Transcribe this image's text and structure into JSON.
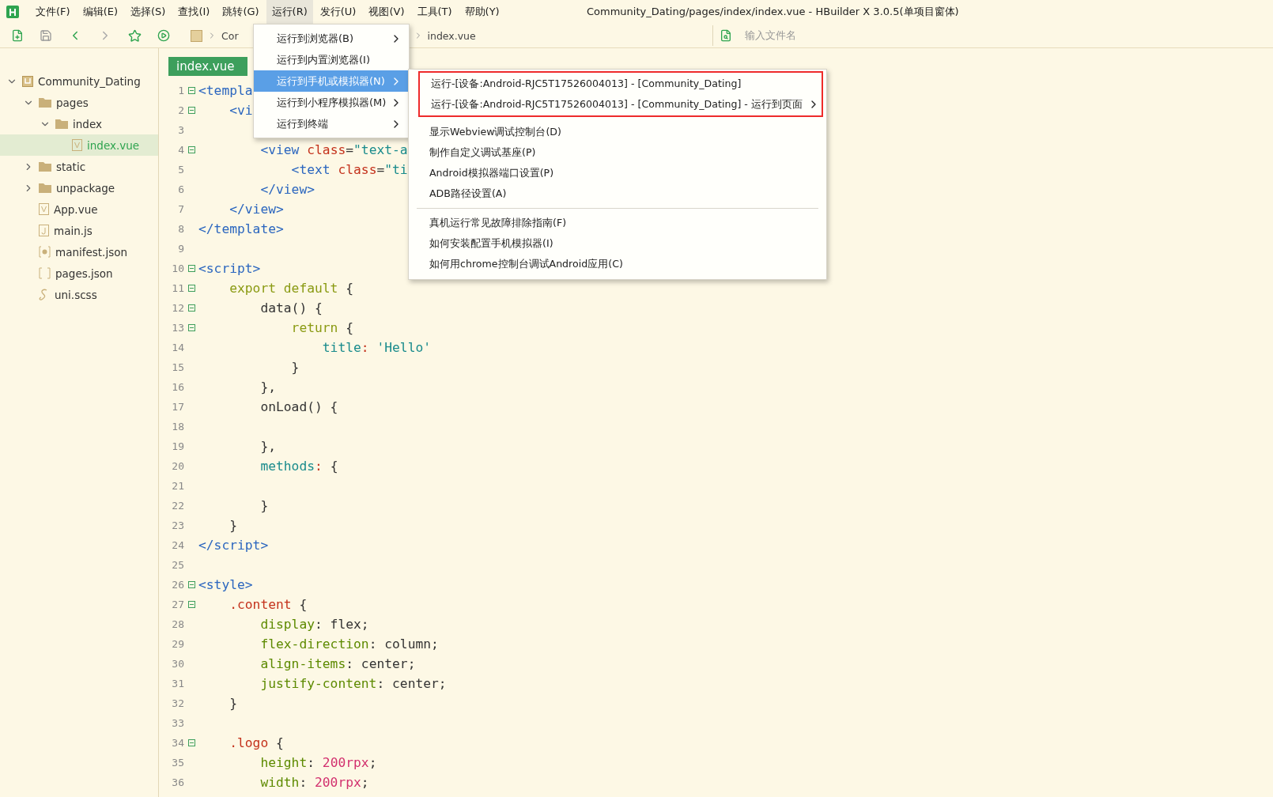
{
  "window": {
    "title": "Community_Dating/pages/index/index.vue - HBuilder X 3.0.5(单项目窗体)"
  },
  "menu_bar": [
    {
      "label": "文件(F)",
      "selected": false
    },
    {
      "label": "编辑(E)",
      "selected": false
    },
    {
      "label": "选择(S)",
      "selected": false
    },
    {
      "label": "查找(I)",
      "selected": false
    },
    {
      "label": "跳转(G)",
      "selected": false
    },
    {
      "label": "运行(R)",
      "selected": true
    },
    {
      "label": "发行(U)",
      "selected": false
    },
    {
      "label": "视图(V)",
      "selected": false
    },
    {
      "label": "工具(T)",
      "selected": false
    },
    {
      "label": "帮助(Y)",
      "selected": false
    }
  ],
  "toolbar": {
    "breadcrumb": [
      "Cor",
      "index.vue"
    ],
    "search": {
      "placeholder": "输入文件名"
    }
  },
  "sidebar": {
    "tree": [
      {
        "label": "Community_Dating",
        "kind": "project",
        "expanded": true,
        "selected": false,
        "children": [
          {
            "label": "pages",
            "kind": "folder",
            "expanded": true,
            "selected": false,
            "children": [
              {
                "label": "index",
                "kind": "folder",
                "expanded": true,
                "selected": false,
                "children": [
                  {
                    "label": "index.vue",
                    "kind": "vue",
                    "selected": true
                  }
                ]
              }
            ]
          },
          {
            "label": "static",
            "kind": "folder",
            "expanded": false,
            "selected": false
          },
          {
            "label": "unpackage",
            "kind": "folder",
            "expanded": false,
            "selected": false
          },
          {
            "label": "App.vue",
            "kind": "vue",
            "selected": false
          },
          {
            "label": "main.js",
            "kind": "js",
            "selected": false
          },
          {
            "label": "manifest.json",
            "kind": "config",
            "selected": false
          },
          {
            "label": "pages.json",
            "kind": "json",
            "selected": false
          },
          {
            "label": "uni.scss",
            "kind": "scss",
            "selected": false
          }
        ]
      }
    ]
  },
  "editor": {
    "tabs": [
      {
        "label": "index.vue",
        "selected": true
      }
    ],
    "lines": [
      {
        "n": "1",
        "fold": true,
        "tokens": [
          {
            "text": "<templa",
            "kind": "tag"
          }
        ]
      },
      {
        "n": "2",
        "fold": true,
        "tokens": [
          {
            "text": "    <vi",
            "kind": "tag"
          }
        ]
      },
      {
        "n": "3",
        "fold": false
      },
      {
        "n": "4",
        "fold": true,
        "tokens": [
          {
            "text": "        <view ",
            "kind": "tag"
          },
          {
            "text": "class",
            "kind": "attr"
          },
          {
            "text": "=",
            "kind": "plain"
          },
          {
            "text": "\"text-a",
            "kind": "str"
          }
        ]
      },
      {
        "n": "5",
        "fold": false,
        "tokens": [
          {
            "text": "            <text ",
            "kind": "tag"
          },
          {
            "text": "class",
            "kind": "attr"
          },
          {
            "text": "=",
            "kind": "plain"
          },
          {
            "text": "\"ti",
            "kind": "str"
          }
        ]
      },
      {
        "n": "6",
        "fold": false,
        "tokens": [
          {
            "text": "        </view>",
            "kind": "tag"
          }
        ]
      },
      {
        "n": "7",
        "fold": false,
        "tokens": [
          {
            "text": "    </view>",
            "kind": "tag"
          }
        ]
      },
      {
        "n": "8",
        "fold": false,
        "tokens": [
          {
            "text": "</template>",
            "kind": "tag"
          }
        ]
      },
      {
        "n": "9",
        "fold": false
      },
      {
        "n": "10",
        "fold": true,
        "tokens": [
          {
            "text": "<script>",
            "kind": "tag"
          }
        ]
      },
      {
        "n": "11",
        "fold": true,
        "tokens": [
          {
            "text": "    export default",
            "kind": "kw"
          },
          {
            "text": " {",
            "kind": "plain"
          }
        ]
      },
      {
        "n": "12",
        "fold": true,
        "tokens": [
          {
            "text": "        data() {",
            "kind": "plain"
          }
        ]
      },
      {
        "n": "13",
        "fold": true,
        "tokens": [
          {
            "text": "            return",
            "kind": "kw"
          },
          {
            "text": " {",
            "kind": "plain"
          }
        ]
      },
      {
        "n": "14",
        "fold": false,
        "tokens": [
          {
            "text": "                title",
            "kind": "prop"
          },
          {
            "text": ":",
            "kind": "attr"
          },
          {
            "text": " 'Hello'",
            "kind": "str"
          }
        ]
      },
      {
        "n": "15",
        "fold": false,
        "tokens": [
          {
            "text": "            }",
            "kind": "plain"
          }
        ]
      },
      {
        "n": "16",
        "fold": false,
        "tokens": [
          {
            "text": "        },",
            "kind": "plain"
          }
        ]
      },
      {
        "n": "17",
        "fold": false,
        "tokens": [
          {
            "text": "        onLoad() {",
            "kind": "plain"
          }
        ]
      },
      {
        "n": "18",
        "fold": false
      },
      {
        "n": "19",
        "fold": false,
        "tokens": [
          {
            "text": "        },",
            "kind": "plain"
          }
        ]
      },
      {
        "n": "20",
        "fold": false,
        "tokens": [
          {
            "text": "        methods",
            "kind": "prop"
          },
          {
            "text": ":",
            "kind": "attr"
          },
          {
            "text": " {",
            "kind": "plain"
          }
        ]
      },
      {
        "n": "21",
        "fold": false
      },
      {
        "n": "22",
        "fold": false,
        "tokens": [
          {
            "text": "        }",
            "kind": "plain"
          }
        ]
      },
      {
        "n": "23",
        "fold": false,
        "tokens": [
          {
            "text": "    }",
            "kind": "plain"
          }
        ]
      },
      {
        "n": "24",
        "fold": false,
        "tokens": [
          {
            "text": "</script>",
            "kind": "tag"
          }
        ]
      },
      {
        "n": "25",
        "fold": false
      },
      {
        "n": "26",
        "fold": true,
        "tokens": [
          {
            "text": "<style>",
            "kind": "tag"
          }
        ]
      },
      {
        "n": "27",
        "fold": true,
        "tokens": [
          {
            "text": "    .content",
            "kind": "attr"
          },
          {
            "text": " {",
            "kind": "plain"
          }
        ]
      },
      {
        "n": "28",
        "fold": false,
        "tokens": [
          {
            "text": "        display",
            "kind": "cssprop"
          },
          {
            "text": ": flex;",
            "kind": "plain"
          }
        ]
      },
      {
        "n": "29",
        "fold": false,
        "tokens": [
          {
            "text": "        flex-direction",
            "kind": "cssprop"
          },
          {
            "text": ": column;",
            "kind": "plain"
          }
        ]
      },
      {
        "n": "30",
        "fold": false,
        "tokens": [
          {
            "text": "        align-items",
            "kind": "cssprop"
          },
          {
            "text": ": center;",
            "kind": "plain"
          }
        ]
      },
      {
        "n": "31",
        "fold": false,
        "tokens": [
          {
            "text": "        justify-content",
            "kind": "cssprop"
          },
          {
            "text": ": center;",
            "kind": "plain"
          }
        ]
      },
      {
        "n": "32",
        "fold": false,
        "tokens": [
          {
            "text": "    }",
            "kind": "plain"
          }
        ]
      },
      {
        "n": "33",
        "fold": false
      },
      {
        "n": "34",
        "fold": true,
        "tokens": [
          {
            "text": "    .logo",
            "kind": "attr"
          },
          {
            "text": " {",
            "kind": "plain"
          }
        ]
      },
      {
        "n": "35",
        "fold": false,
        "tokens": [
          {
            "text": "        height",
            "kind": "cssprop"
          },
          {
            "text": ": ",
            "kind": "plain"
          },
          {
            "text": "200rpx",
            "kind": "num"
          },
          {
            "text": ";",
            "kind": "plain"
          }
        ]
      },
      {
        "n": "36",
        "fold": false,
        "tokens": [
          {
            "text": "        width",
            "kind": "cssprop"
          },
          {
            "text": ": ",
            "kind": "plain"
          },
          {
            "text": "200rpx",
            "kind": "num"
          },
          {
            "text": ";",
            "kind": "plain"
          }
        ]
      }
    ]
  },
  "run_menu": {
    "items": [
      {
        "label": "运行到浏览器(B)",
        "submenu": true,
        "selected": false
      },
      {
        "label": "运行到内置浏览器(I)",
        "submenu": false,
        "selected": false
      },
      {
        "label": "运行到手机或模拟器(N)",
        "submenu": true,
        "selected": true
      },
      {
        "label": "运行到小程序模拟器(M)",
        "submenu": true,
        "selected": false
      },
      {
        "label": "运行到终端",
        "submenu": true,
        "selected": false
      }
    ]
  },
  "device_submenu": {
    "groups": [
      {
        "highlighted": true,
        "items": [
          {
            "label": "运行-[设备:Android-RJC5T17526004013] - [Community_Dating]",
            "submenu": false
          },
          {
            "label": "运行-[设备:Android-RJC5T17526004013] - [Community_Dating] - 运行到页面",
            "submenu": true
          }
        ]
      },
      {
        "highlighted": false,
        "items": [
          {
            "label": "显示Webview调试控制台(D)",
            "submenu": false
          },
          {
            "label": "制作自定义调试基座(P)",
            "submenu": false
          },
          {
            "label": "Android模拟器端口设置(P)",
            "submenu": false
          },
          {
            "label": "ADB路径设置(A)",
            "submenu": false
          }
        ]
      },
      {
        "highlighted": false,
        "items": [
          {
            "label": "真机运行常见故障排除指南(F)",
            "submenu": false
          },
          {
            "label": "如何安装配置手机模拟器(I)",
            "submenu": false
          },
          {
            "label": "如何用chrome控制台调试Android应用(C)",
            "submenu": false
          }
        ]
      }
    ]
  }
}
